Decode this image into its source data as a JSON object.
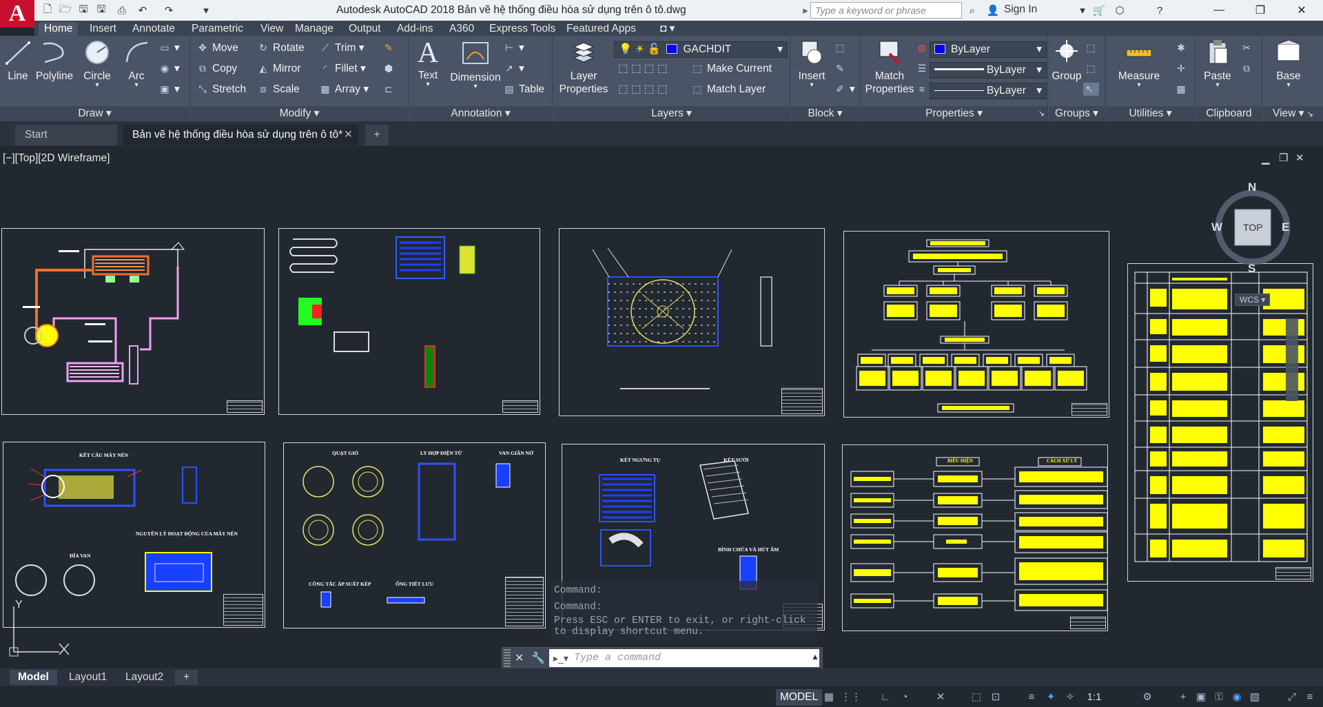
{
  "app": {
    "title": "Autodesk AutoCAD 2018    Bản vẽ hệ thống điều hòa sử dụng trên ô tô.dwg",
    "logo_letter": "A",
    "search_placeholder": "Type a keyword or phrase",
    "sign_in": "Sign In"
  },
  "ribbon_tabs": [
    "Home",
    "Insert",
    "Annotate",
    "Parametric",
    "View",
    "Manage",
    "Output",
    "Add-ins",
    "A360",
    "Express Tools",
    "Featured Apps"
  ],
  "draw_panel": {
    "title": "Draw",
    "line": "Line",
    "polyline": "Polyline",
    "circle": "Circle",
    "arc": "Arc"
  },
  "modify_panel": {
    "title": "Modify",
    "move": "Move",
    "rotate": "Rotate",
    "trim": "Trim",
    "copy": "Copy",
    "mirror": "Mirror",
    "fillet": "Fillet",
    "stretch": "Stretch",
    "scale": "Scale",
    "array": "Array"
  },
  "annotation_panel": {
    "title": "Annotation",
    "text": "Text",
    "dimension": "Dimension",
    "table": "Table"
  },
  "layers_panel": {
    "title": "Layers",
    "layer_properties": "Layer\nProperties",
    "current_layer": "GACHDIT",
    "current_layer_color": "#0000ff",
    "make_current": "Make Current",
    "match_layer": "Match Layer"
  },
  "block_panel": {
    "title": "Block",
    "insert": "Insert"
  },
  "properties_panel": {
    "title": "Properties",
    "match_properties": "Match\nProperties",
    "color": "ByLayer",
    "linetype": "ByLayer",
    "lineweight": "ByLayer"
  },
  "groups_panel": {
    "title": "Groups",
    "group": "Group"
  },
  "utilities_panel": {
    "title": "Utilities",
    "measure": "Measure"
  },
  "clipboard_panel": {
    "title": "Clipboard",
    "paste": "Paste"
  },
  "view_panel": {
    "title": "View",
    "base": "Base"
  },
  "file_tabs": [
    {
      "label": "Start"
    },
    {
      "label": "Bản vẽ hệ thống điều hòa sử dụng trên ô tô*"
    }
  ],
  "viewport_label": "[−][Top][2D Wireframe]",
  "viewcube": {
    "n": "N",
    "s": "S",
    "e": "E",
    "w": "W",
    "face": "TOP",
    "wcs": "WCS"
  },
  "sheets": {
    "s5_title_a": "KẾT CẤU MÁY NÉN",
    "s5_title_b": "NGUYÊN LÝ HOẠT ĐỘNG CỦA MÁY NÉN",
    "s5_title_c": "ĐĨA VAN",
    "s6_title_a": "QUẠT GIÓ",
    "s6_title_b": "LY HỢP ĐIỆN TỪ",
    "s6_title_c": "VAN GIÃN NỞ",
    "s6_title_d": "CÔNG TẮC ÁP SUẤT KÉP",
    "s6_title_e": "ỐNG TIẾT LƯU",
    "s7_title_a": "KÉT NGƯNG TỤ",
    "s7_title_b": "KÉT SƯỞI",
    "s7_title_c": "BÌNH CHỨA VÀ HÚT ẨM",
    "s8_head_a": "BIỂU HIỆN",
    "s8_head_b": "CÁCH XỬ LÝ"
  },
  "command": {
    "history": [
      "Command:",
      "Command:",
      "Press ESC or ENTER to exit, or right-click",
      "to display shortcut menu."
    ],
    "placeholder": "Type a command"
  },
  "layout_tabs": [
    "Model",
    "Layout1",
    "Layout2"
  ],
  "status": {
    "model": "MODEL",
    "scale": "1:1"
  }
}
